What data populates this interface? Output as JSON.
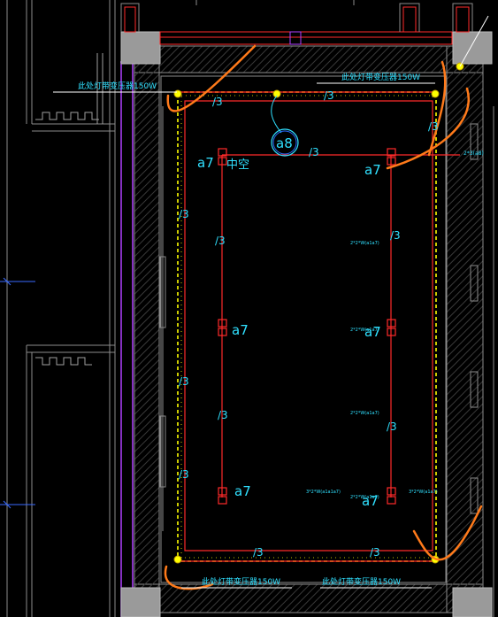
{
  "drawing": {
    "background": "#000000",
    "colors": {
      "wall": "#8c8c8c",
      "hatch": "#3a3a3a",
      "wire_red": "#ff2a2a",
      "light_strip": "#ffff00",
      "text_cyan": "#30e0ff",
      "annot_orange": "#ff7a1a",
      "purple": "#b040ff",
      "grid_blue": "#3a6aff",
      "white": "#ffffff"
    },
    "labels": {
      "transformer_top_right": "此处灯带变压器150W",
      "transformer_top_left": "此处灯带变压器150W",
      "transformer_bottom_left": "此处灯带变压器150W",
      "transformer_bottom_right": "此处灯带变压器150W",
      "void": "中空",
      "circle_tag": "a8",
      "a7": "a7",
      "wire_count": "/3",
      "spec_right_top": "2*3(a8)",
      "spec_mid_1": "2*2*W(a1a7)",
      "spec_mid_2": "2*2*W(a1a7)",
      "spec_mid_3": "2*2*W(a1a7)",
      "spec_bottom_left": "3*2*W(a1a1a7)",
      "spec_bottom_mid": "2*2*W(a1a7)",
      "spec_bottom_right": "3*2*W(a1a7)"
    }
  }
}
